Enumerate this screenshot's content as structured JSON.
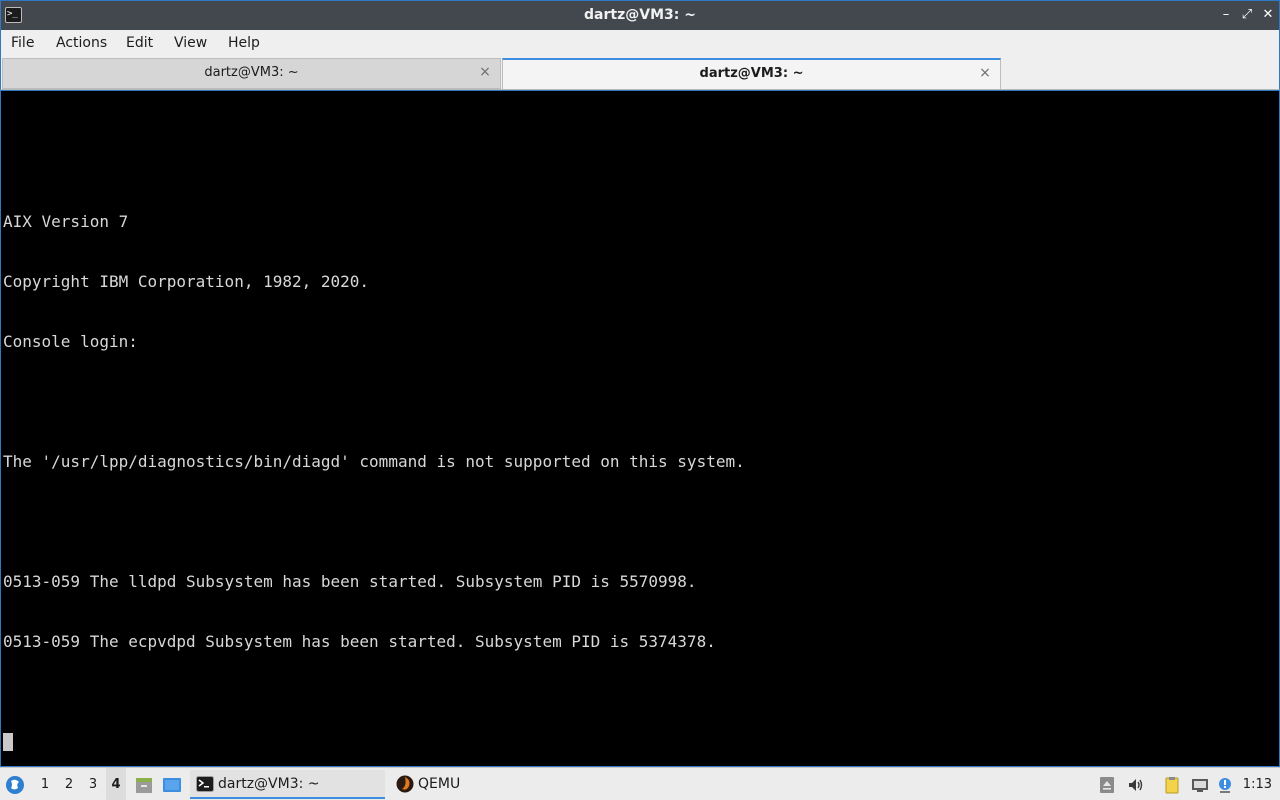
{
  "window": {
    "title": "dartz@VM3: ~",
    "app_icon_glyph": ">_",
    "controls": {
      "minimize": "–",
      "maximize": "⤢",
      "close": "✕"
    }
  },
  "menubar": [
    "File",
    "Actions",
    "Edit",
    "View",
    "Help"
  ],
  "tabs": [
    {
      "label": "dartz@VM3: ~",
      "active": false
    },
    {
      "label": "dartz@VM3: ~",
      "active": true
    }
  ],
  "tab_close_glyph": "×",
  "terminal": {
    "lines": [
      "AIX Version 7",
      "Copyright IBM Corporation, 1982, 2020.",
      "Console login:",
      "",
      "The '/usr/lpp/diagnostics/bin/diagd' command is not supported on this system.",
      "",
      "0513-059 The lldpd Subsystem has been started. Subsystem PID is 5570998.",
      "0513-059 The ecpvdpd Subsystem has been started. Subsystem PID is 5374378."
    ],
    "background": "#000000",
    "foreground": "#d8d8d8"
  },
  "taskbar": {
    "workspaces": [
      "1",
      "2",
      "3",
      "4"
    ],
    "current_workspace": "4",
    "tasks": [
      {
        "label": "dartz@VM3: ~",
        "icon": "terminal-icon",
        "active": true
      },
      {
        "label": "QEMU",
        "icon": "qemu-icon",
        "active": false
      }
    ],
    "clock": "1:13"
  },
  "colors": {
    "accent": "#3d8ee0",
    "titlebar": "#43484e"
  }
}
